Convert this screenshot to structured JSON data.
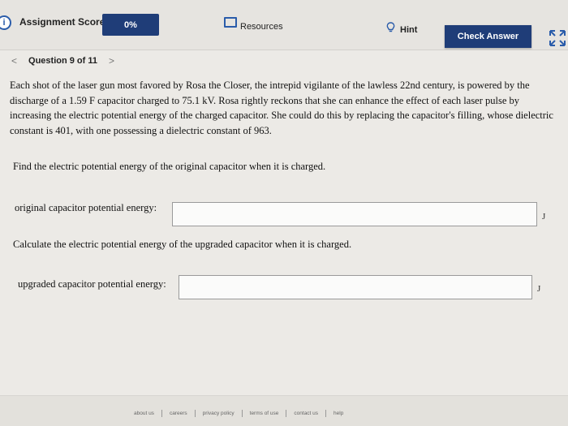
{
  "header": {
    "score_label": "Assignment Score:",
    "score_value": "0%",
    "resources_label": "Resources",
    "hint_label": "Hint",
    "check_answer_label": "Check Answer"
  },
  "question_nav": {
    "prev": "<",
    "label": "Question 9 of 11",
    "next": ">"
  },
  "question": {
    "text": "Each shot of the laser gun most favored by Rosa the Closer, the intrepid vigilante of the lawless 22nd century, is powered by the discharge of a 1.59 F capacitor charged to 75.1 kV. Rosa rightly reckons that she can enhance the effect of each laser pulse by increasing the electric potential energy of the charged capacitor. She could do this by replacing the capacitor's filling, whose dielectric constant is 401, with one possessing a dielectric constant of 963.",
    "prompt1": "Find the electric potential energy of the original capacitor when it is charged.",
    "prompt2": "Calculate the electric potential energy of the upgraded capacitor when it is charged."
  },
  "answers": [
    {
      "label": "original capacitor potential energy:",
      "value": "",
      "unit": "J"
    },
    {
      "label": "upgraded capacitor potential energy:",
      "value": "",
      "unit": "J"
    }
  ],
  "footer": {
    "links": [
      "about us",
      "careers",
      "privacy policy",
      "terms of use",
      "contact us",
      "help"
    ]
  },
  "colors": {
    "accent": "#1f3d78",
    "icon_blue": "#2a5caa"
  },
  "icons": {
    "info": "info-icon",
    "resources": "resources-icon",
    "hint": "lightbulb-icon",
    "expand": "expand-icon"
  }
}
